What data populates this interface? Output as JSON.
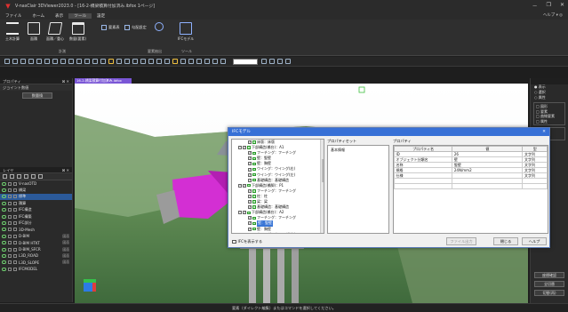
{
  "titlebar": {
    "title": "V-nasClair 3DViewer2023.0 - [16-2-橋梁積算付加済み.ibfox 1ページ]",
    "controls": [
      "－",
      "❐",
      "✕"
    ]
  },
  "menu": [
    "ファイル",
    "ホーム",
    "表示",
    "ツール",
    "設定"
  ],
  "menu_active_index": 3,
  "help_text": "ヘルプ ▾  ◎",
  "ribbon": {
    "buttons": [
      {
        "label": "土木計算"
      },
      {
        "label": "面積"
      },
      {
        "label": "面積／重心"
      },
      {
        "label": "数量(要素)"
      },
      {
        "label": "IFCモデル"
      }
    ],
    "small_buttons": [
      "要素表",
      "勾配設定"
    ],
    "groups": [
      "計測",
      "要素抽出",
      "ツール"
    ]
  },
  "left_panels": {
    "property_title": "プロパティ",
    "property_sub": "ジョイント数値",
    "property_button": "数量換",
    "layer_title": "レイヤ",
    "layers": [
      {
        "name": "V-nasOTD",
        "count": ""
      },
      {
        "name": "橋梁",
        "count": ""
      },
      {
        "name": "標準",
        "count": ""
      },
      {
        "name": "積算",
        "count": ""
      },
      {
        "name": "IFC構造",
        "count": ""
      },
      {
        "name": "IFC構築",
        "count": ""
      },
      {
        "name": "IFC部分",
        "count": ""
      },
      {
        "name": "3D-Mesh",
        "count": ""
      },
      {
        "name": "D-BIM",
        "count": "図面"
      },
      {
        "name": "D-BIM HTKT",
        "count": "図面"
      },
      {
        "name": "D-BIM_SFCR",
        "count": "図面"
      },
      {
        "name": "L3D_ROAD",
        "count": "図面"
      },
      {
        "name": "L3D_SLOPE",
        "count": "図面"
      },
      {
        "name": "IFCMODEL",
        "count": ""
      }
    ],
    "selected_layer_index": 2,
    "close_symbol": "⊠ ✕"
  },
  "viewport": {
    "tab_label": "16-2-橋梁積算付加済み.ibfox"
  },
  "right_panel": {
    "options": [
      "● 表示",
      "○ 選択",
      "○ 属性"
    ],
    "box1": [
      "□ 図形",
      "□ 要素",
      "□ 曲線要素",
      "□ 属性"
    ],
    "radio2": [
      "● 外周",
      "○ 内部"
    ],
    "side_text": [
      "要",
      "素"
    ],
    "buttons": [
      "座標確認",
      "全切替",
      "切替(再)"
    ]
  },
  "status_text": "要素（ダイレクト編集）またはコマンドを選択してください。",
  "dialog": {
    "title": "IFCモデル",
    "close": "✕",
    "tree": [
      {
        "indent": 2,
        "tog": "",
        "label": "床版：床版"
      },
      {
        "indent": 1,
        "tog": "−",
        "label": "下部構造(橋台)：A1"
      },
      {
        "indent": 2,
        "tog": "",
        "label": "フーチング：フーチング"
      },
      {
        "indent": 2,
        "tog": "",
        "label": "壁：竪壁"
      },
      {
        "indent": 2,
        "tog": "",
        "label": "壁：胸壁"
      },
      {
        "indent": 2,
        "tog": "",
        "label": "ウイング：ウイング(右)"
      },
      {
        "indent": 2,
        "tog": "",
        "label": "ウイング：ウイング(左)"
      },
      {
        "indent": 2,
        "tog": "",
        "label": "基礎構造：基礎構造"
      },
      {
        "indent": 1,
        "tog": "−",
        "label": "下部構造(橋脚)：P1"
      },
      {
        "indent": 2,
        "tog": "",
        "label": "フーチング：フーチング"
      },
      {
        "indent": 2,
        "tog": "",
        "label": "柱：柱"
      },
      {
        "indent": 2,
        "tog": "",
        "label": "梁：梁"
      },
      {
        "indent": 2,
        "tog": "",
        "label": "基礎構造：基礎構造"
      },
      {
        "indent": 1,
        "tog": "−",
        "label": "下部構造(橋台)：A2"
      },
      {
        "indent": 2,
        "tog": "",
        "label": "フーチング：フーチング"
      },
      {
        "indent": 2,
        "tog": "",
        "label": "壁：竪壁",
        "selected": true
      },
      {
        "indent": 2,
        "tog": "",
        "label": "壁：胸壁"
      },
      {
        "indent": 2,
        "tog": "",
        "label": "ウイング：ウイング(右)"
      },
      {
        "indent": 2,
        "tog": "",
        "label": "ウイング：ウイング(左)"
      },
      {
        "indent": 2,
        "tog": "",
        "label": "基礎構造：基礎構造"
      }
    ],
    "pset_label": "プロパティセット",
    "pset_items": [
      "基本情報"
    ],
    "prop_label": "プロパティ",
    "table_headers": [
      "プロパティ名",
      "値",
      "型"
    ],
    "table_rows": [
      [
        "ID",
        "26",
        "文字列"
      ],
      [
        "オブジェクト分類名",
        "壁",
        "文字列"
      ],
      [
        "名称",
        "竪壁",
        "文字列"
      ],
      [
        "規格",
        "24N/mm2",
        "文字列"
      ],
      [
        "仕様",
        "",
        "文字列"
      ],
      [
        "",
        "",
        ""
      ],
      [
        "",
        "",
        ""
      ]
    ],
    "show_all_label": "IFCを表示する",
    "btn_file": "ファイル出力",
    "btn_close": "閉じる",
    "btn_help": "ヘルプ"
  }
}
